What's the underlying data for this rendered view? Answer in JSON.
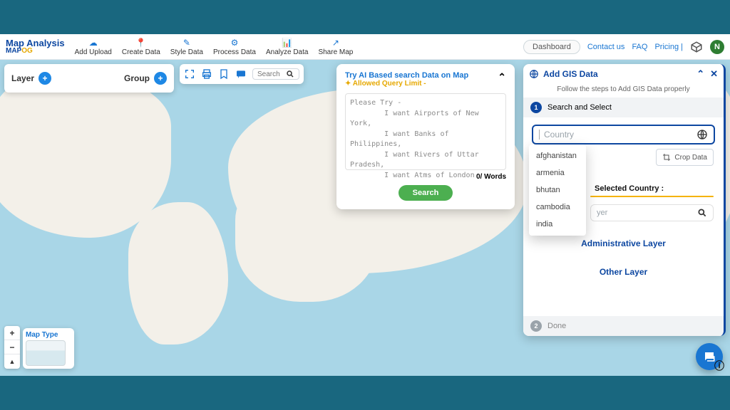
{
  "app": {
    "title": "Map Analysis",
    "sublogo_a": "MAP",
    "sublogo_b": "OG"
  },
  "menu": [
    {
      "icon": "☁",
      "label": "Add Upload"
    },
    {
      "icon": "📍",
      "label": "Create Data"
    },
    {
      "icon": "✎",
      "label": "Style Data"
    },
    {
      "icon": "⚙",
      "label": "Process Data"
    },
    {
      "icon": "📊",
      "label": "Analyze Data"
    },
    {
      "icon": "↗",
      "label": "Share Map"
    }
  ],
  "top_right": {
    "dashboard": "Dashboard",
    "contact": "Contact us",
    "faq": "FAQ",
    "pricing": "Pricing |",
    "avatar": "N"
  },
  "layer_panel": {
    "layer": "Layer",
    "group": "Group"
  },
  "toolbar_search_ph": "Search",
  "zoom": {
    "in": "+",
    "out": "−",
    "reset": "▲"
  },
  "maptype_title": "Map Type",
  "ai": {
    "title1": "Try AI Based search Data on Map",
    "title2": "✦ Allowed Query Limit -",
    "placeholder": "Please Try -\n        I want Airports of New York,\n        I want Banks of Philippines,\n        I want Rivers of Uttar Pradesh,\n        I want Atms of London",
    "count": "0/ Words",
    "search_btn": "Search"
  },
  "gis": {
    "title": "Add GIS Data",
    "subtitle": "Follow the steps to Add GIS Data properly",
    "step1": "Search and Select",
    "country_ph": "Country",
    "dropdown": [
      "afghanistan",
      "armenia",
      "bhutan",
      "cambodia",
      "india"
    ],
    "crop": "Crop Data",
    "selected_label": "Selected Country :",
    "layer_search_ph": "yer",
    "admin_layer": "Administrative Layer",
    "other_layer": "Other Layer",
    "step2": "Done"
  }
}
